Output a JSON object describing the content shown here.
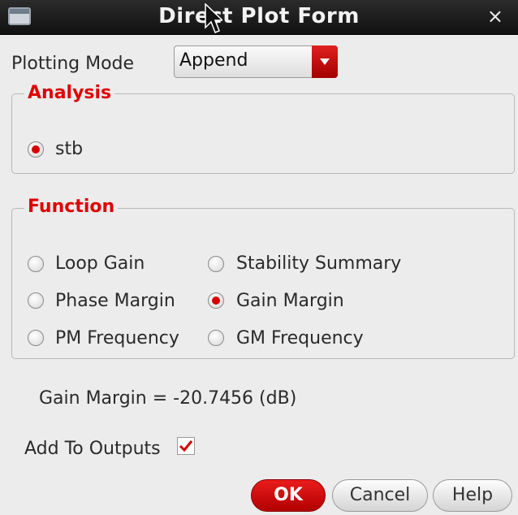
{
  "window": {
    "title": "Direct Plot Form",
    "close_glyph": "×"
  },
  "plotting_mode": {
    "label": "Plotting Mode",
    "value": "Append"
  },
  "analysis": {
    "title": "Analysis",
    "options": [
      {
        "label": "stb",
        "selected": true
      }
    ]
  },
  "function": {
    "title": "Function",
    "options": [
      {
        "label": "Loop Gain",
        "selected": false
      },
      {
        "label": "Stability Summary",
        "selected": false
      },
      {
        "label": "Phase Margin",
        "selected": false
      },
      {
        "label": "Gain Margin",
        "selected": true
      },
      {
        "label": "PM Frequency",
        "selected": false
      },
      {
        "label": "GM Frequency",
        "selected": false
      }
    ]
  },
  "result": {
    "text": "Gain Margin = -20.7456 (dB)"
  },
  "add_to_outputs": {
    "label": "Add To Outputs",
    "checked": true
  },
  "buttons": {
    "ok": "OK",
    "cancel": "Cancel",
    "help": "Help"
  },
  "colors": {
    "accent": "#d40000",
    "titlebar": "#1a1a1a"
  }
}
